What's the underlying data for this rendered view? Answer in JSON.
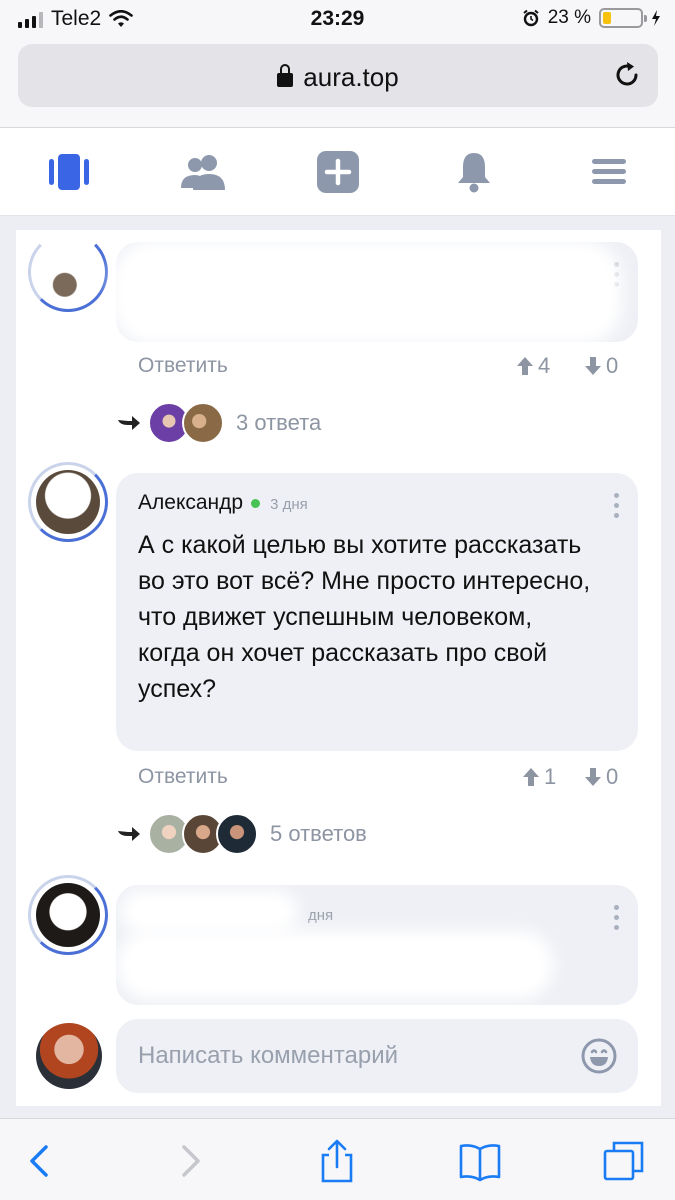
{
  "status_bar": {
    "carrier": "Tele2",
    "time": "23:29",
    "battery_percent": "23 %",
    "battery_level": 0.23
  },
  "browser": {
    "url": "aura.top"
  },
  "app_nav": {
    "icons": [
      "feed-icon",
      "friends-icon",
      "add-post-icon",
      "notifications-icon",
      "menu-icon"
    ]
  },
  "comments": [
    {
      "author": "",
      "text": "",
      "reply_label": "Ответить",
      "upvotes": "4",
      "downvotes": "0",
      "replies_label": "3 ответа"
    },
    {
      "author": "Александр",
      "time": "3 дня",
      "online": true,
      "text": "А с какой целью вы хотите рассказать во это вот всё? Мне просто интересно, что движет успешным человеком, когда он хочет рассказать про свой успех?",
      "reply_label": "Ответить",
      "upvotes": "1",
      "downvotes": "0",
      "replies_label": "5 ответов"
    },
    {
      "author": "",
      "time": "дня",
      "text": ""
    }
  ],
  "composer": {
    "placeholder": "Написать комментарий"
  },
  "colors": {
    "accent": "#4a6fd6",
    "nav_icon": "#8e98ad",
    "online": "#47c254",
    "ios_blue": "#1a7cf5"
  }
}
